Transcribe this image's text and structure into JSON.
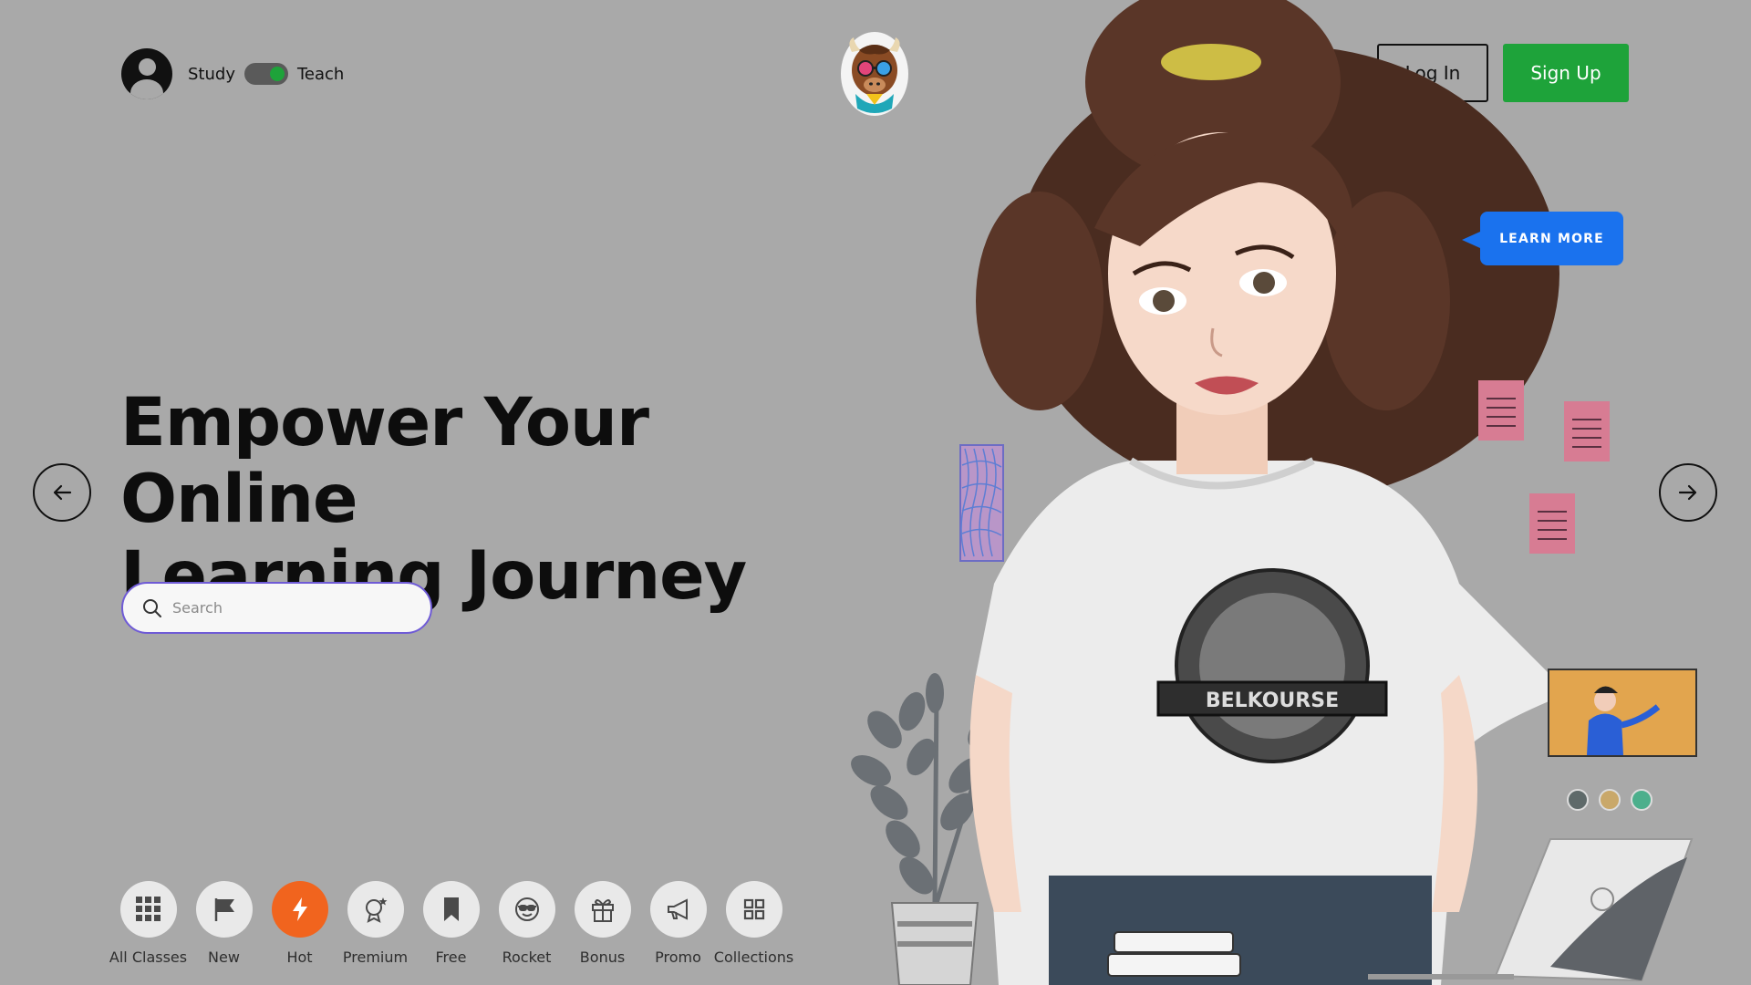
{
  "header": {
    "mode_left_label": "Study",
    "mode_right_label": "Teach",
    "login_label": "Log In",
    "signup_label": "Sign Up"
  },
  "hero": {
    "title_line1": "Empower Your Online",
    "title_line2": "Learning Journey",
    "search_placeholder": "Search",
    "cta_label": "LEARN MORE"
  },
  "categories": [
    {
      "label": "All Classes",
      "icon": "grid-icon",
      "active": false
    },
    {
      "label": "New",
      "icon": "flag-icon",
      "active": false
    },
    {
      "label": "Hot",
      "icon": "lightning-icon",
      "active": true
    },
    {
      "label": "Premium",
      "icon": "badge-star-icon",
      "active": false
    },
    {
      "label": "Free",
      "icon": "bookmark-icon",
      "active": false
    },
    {
      "label": "Rocket",
      "icon": "sunglasses-face-icon",
      "active": false
    },
    {
      "label": "Bonus",
      "icon": "gift-icon",
      "active": false
    },
    {
      "label": "Promo",
      "icon": "megaphone-icon",
      "active": false
    },
    {
      "label": "Collections",
      "icon": "collection-grid-icon",
      "active": false
    }
  ],
  "theme_dots": [
    "#5f6a6a",
    "#c9a86a",
    "#4caf8c"
  ],
  "colors": {
    "background": "#a9a9a9",
    "signup": "#1ea33a",
    "cta": "#1a72ee",
    "active_category": "#f1641e",
    "search_border": "#6f5bd6"
  }
}
